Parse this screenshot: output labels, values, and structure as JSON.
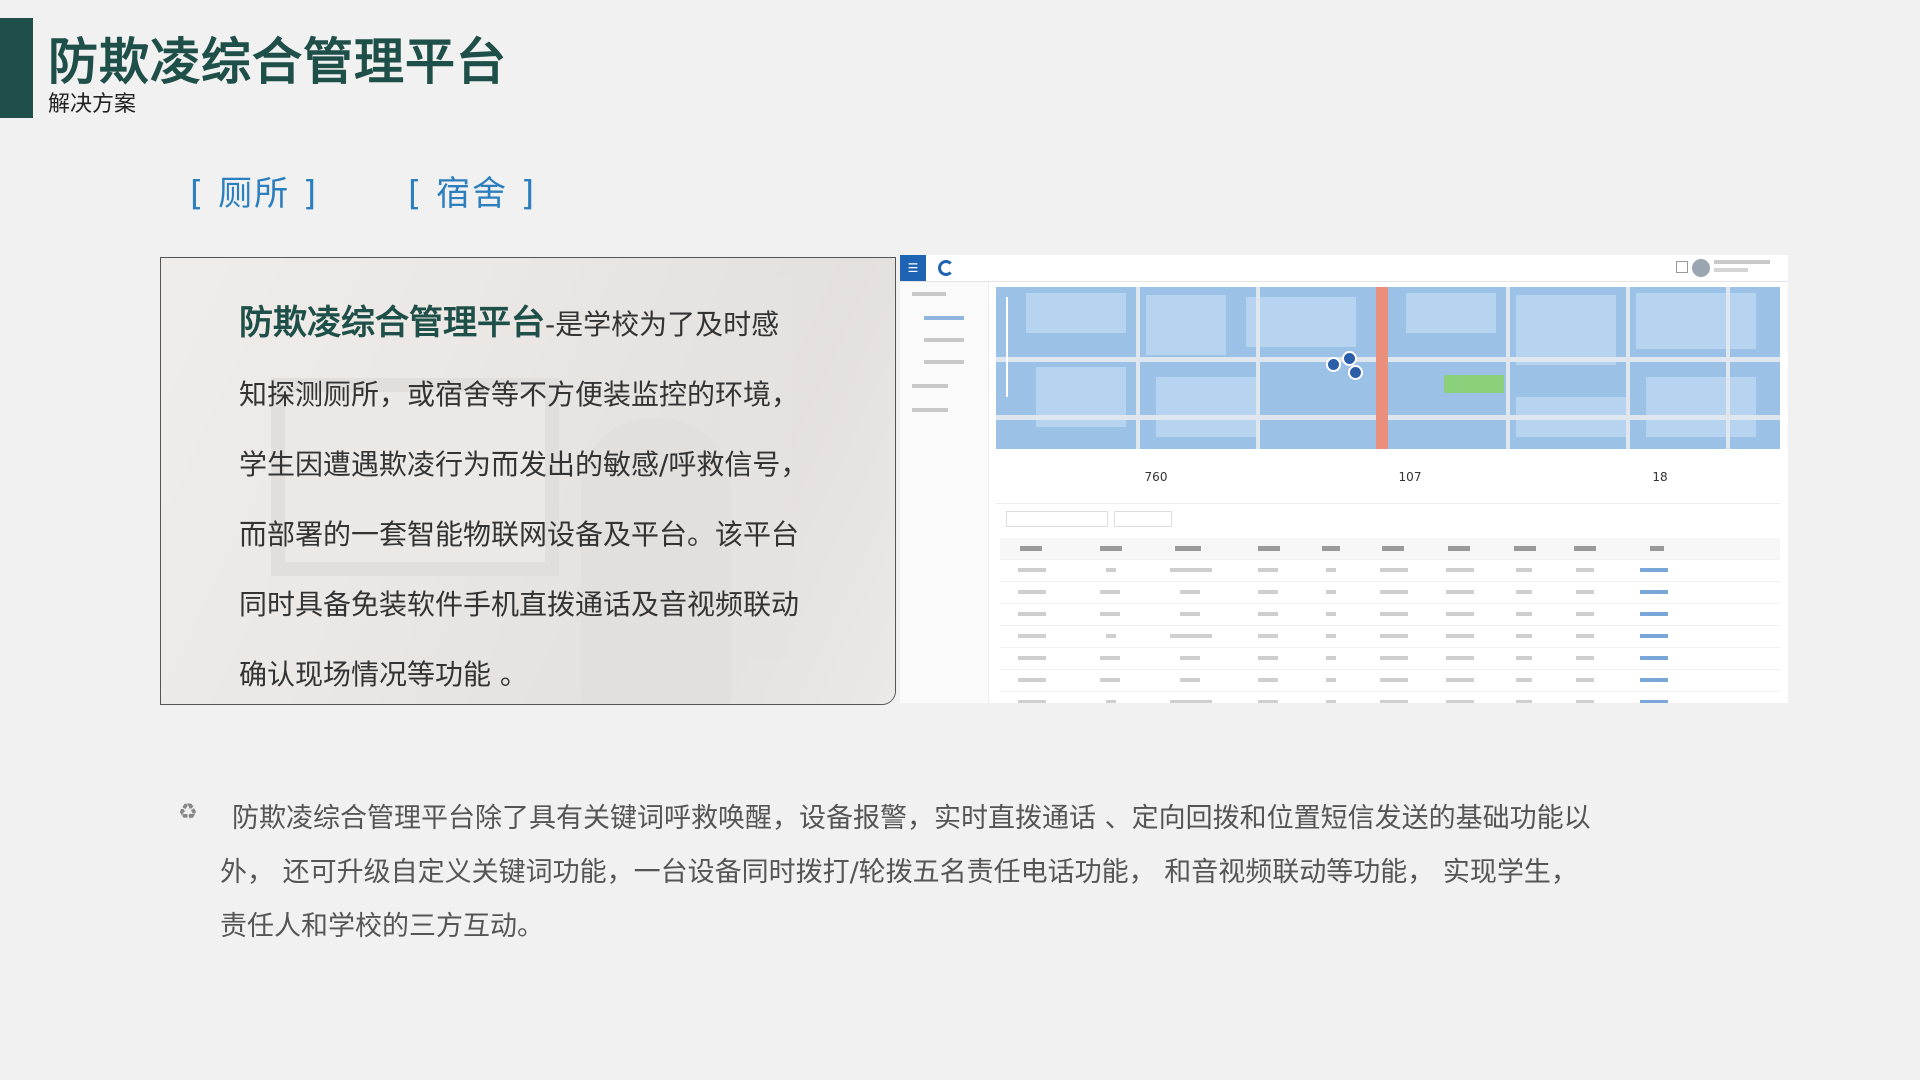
{
  "header": {
    "title": "防欺凌综合管理平台",
    "subtitle": "解决方案"
  },
  "tabs": [
    {
      "label": "[ 厕所  ]"
    },
    {
      "label": "[ 宿舍 ]"
    }
  ],
  "intro": {
    "highlight": "防欺凌综合管理平台",
    "lines": [
      "-是学校为了及时感",
      "知探测厕所，或宿舍等不方便装监控的环境，",
      "学生因遭遇欺凌行为而发出的敏感/呼救信号，",
      "而部署的一套智能物联网设备及平台。该平台",
      "同时具备免装软件手机直拨通话及音视频联动",
      "确认现场情况等功能 。"
    ]
  },
  "dashboard": {
    "stats": [
      {
        "value": "760"
      },
      {
        "value": "107"
      },
      {
        "value": "18"
      }
    ],
    "colors": {
      "primary": "#1e63b4",
      "route": "#e98f7c",
      "park": "#8bd07a",
      "map": "#9cc1e6"
    }
  },
  "bullet": {
    "icon": "recycle-icon",
    "lines": [
      "防欺凌综合管理平台除了具有关键词呼救唤醒，设备报警，实时直拨通话 、定向回拨和位置短信发送的基础功能以",
      "外， 还可升级自定义关键词功能，一台设备同时拨打/轮拨五名责任电话功能， 和音视频联动等功能， 实现学生，",
      "责任人和学校的三方互动。"
    ]
  },
  "colors": {
    "accent": "#1e4f48",
    "tab": "#2c7fbf",
    "background": "#f1f1f1"
  }
}
